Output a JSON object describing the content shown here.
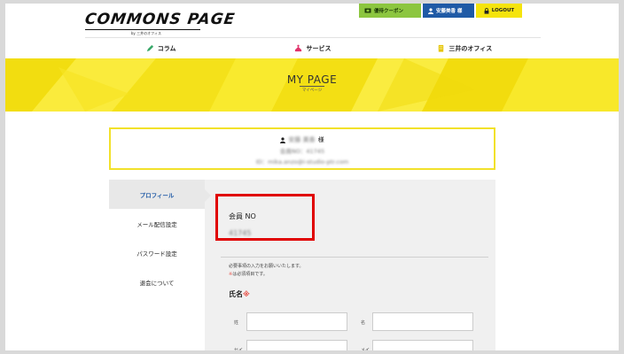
{
  "header": {
    "logo_text": "COMMONS PAGE",
    "logo_sub": "by 三井のオフィス",
    "coupon_label": "優待クーポン",
    "user_label": "安藤美香 様",
    "logout_label": "LOGOUT"
  },
  "nav": {
    "items": [
      {
        "label": "コラム",
        "icon": "pencil-icon"
      },
      {
        "label": "サービス",
        "icon": "service-icon"
      },
      {
        "label": "三井のオフィス",
        "icon": "building-icon"
      }
    ]
  },
  "banner": {
    "title": "MY PAGE",
    "subtitle": "マイページ"
  },
  "userbox": {
    "name": "安藤 美香",
    "honorific": "様",
    "member_no_line": "会員NO：41745",
    "id_line": "ID：mika.anzo@i-studio-ptr.com"
  },
  "sidebar": {
    "items": [
      {
        "label": "プロフィール",
        "active": true
      },
      {
        "label": "メール配信設定",
        "active": false
      },
      {
        "label": "パスワード設定",
        "active": false
      },
      {
        "label": "退会について",
        "active": false
      }
    ]
  },
  "profile": {
    "member_no_label": "会員 NO",
    "member_no_value": "41745",
    "note_line1": "必要事項の入力をお願いいたします。",
    "note_req_mark": "※",
    "note_line2": "は必須項目です。",
    "name_label": "氏名",
    "name_req_mark": "※",
    "last_name_label": "姓",
    "first_name_label": "名",
    "last_kana_label": "セイ",
    "first_kana_label": "メイ"
  },
  "colors": {
    "accent_yellow": "#f7e61a",
    "coupon_green": "#8cc63f",
    "user_blue": "#1f5aa6",
    "highlight_red": "#e00000"
  }
}
